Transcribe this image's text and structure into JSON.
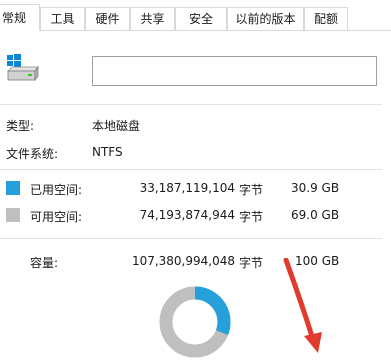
{
  "tabs": [
    {
      "label": "常规"
    },
    {
      "label": "工具"
    },
    {
      "label": "硬件"
    },
    {
      "label": "共享"
    },
    {
      "label": "安全"
    },
    {
      "label": "以前的版本"
    },
    {
      "label": "配额"
    }
  ],
  "general": {
    "drive_name_value": "",
    "type_label": "类型:",
    "type_value": "本地磁盘",
    "fs_label": "文件系统:",
    "fs_value": "NTFS",
    "used": {
      "label": "已用空间:",
      "bytes": "33,187,119,104",
      "unit": "字节",
      "size": "30.9 GB",
      "color": "#26a0da"
    },
    "free": {
      "label": "可用空间:",
      "bytes": "74,193,874,944",
      "unit": "字节",
      "size": "69.0 GB",
      "color": "#bfbfbf"
    },
    "capacity": {
      "label": "容量:",
      "bytes": "107,380,994,048",
      "unit": "字节",
      "size": "100 GB"
    }
  },
  "usage_fraction": 0.309
}
